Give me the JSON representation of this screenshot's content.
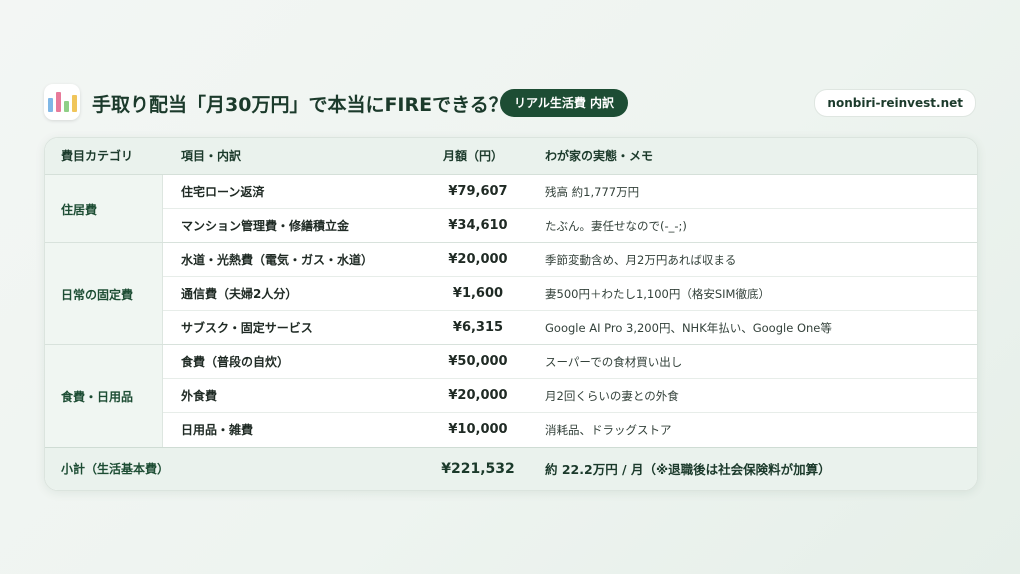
{
  "header": {
    "title": "手取り配当「月30万円」で本当にFIREできる？",
    "badge": "リアル生活費 内訳",
    "site": "nonbiri-reinvest.net",
    "icon": "bar-chart-icon"
  },
  "colors": {
    "accent": "#1d4d34",
    "header_bg": "#eaf2ed"
  },
  "table": {
    "columns": [
      "費目カテゴリ",
      "項目・内訳",
      "月額（円）",
      "わが家の実態・メモ"
    ],
    "categories": [
      "住居費",
      "日常の固定費",
      "食費・日用品"
    ],
    "rows": [
      {
        "item": "住宅ローン返済",
        "amount": "¥79,607",
        "memo": "残高 約1,777万円"
      },
      {
        "item": "マンション管理費・修繕積立金",
        "amount": "¥34,610",
        "memo": "たぶん。妻任せなので(-_-;)"
      },
      {
        "item": "水道・光熱費（電気・ガス・水道）",
        "amount": "¥20,000",
        "memo": "季節変動含め、月2万円あれば収まる"
      },
      {
        "item": "通信費（夫婦2人分）",
        "amount": "¥1,600",
        "memo": "妻500円＋わたし1,100円（格安SIM徹底）"
      },
      {
        "item": "サブスク・固定サービス",
        "amount": "¥6,315",
        "memo": "Google AI Pro 3,200円、NHK年払い、Google One等"
      },
      {
        "item": "食費（普段の自炊）",
        "amount": "¥50,000",
        "memo": "スーパーでの食材買い出し"
      },
      {
        "item": "外食費",
        "amount": "¥20,000",
        "memo": "月2回くらいの妻との外食"
      },
      {
        "item": "日用品・雑費",
        "amount": "¥10,000",
        "memo": "消耗品、ドラッグストア"
      }
    ],
    "total": {
      "label": "小計（生活基本費）",
      "amount": "¥221,532",
      "memo": "約 22.2万円 / 月（※退職後は社会保険料が加算）"
    }
  }
}
